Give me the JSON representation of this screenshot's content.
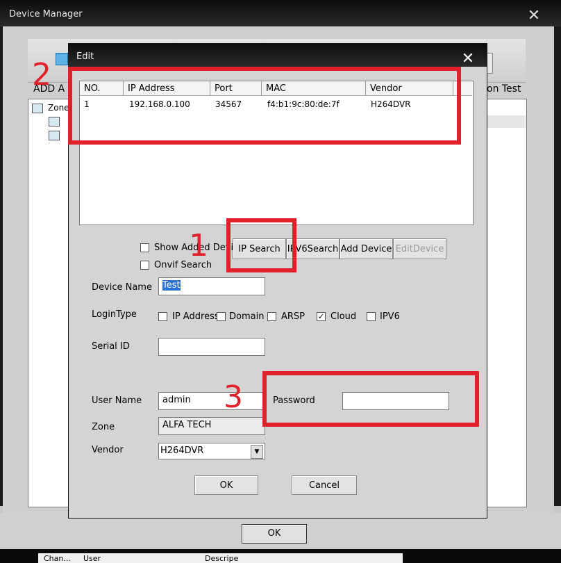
{
  "outer_window": {
    "title": "Device Manager",
    "close_glyph": "✕",
    "toolbar": {
      "left_label": "ADD A",
      "right_label": "on Test"
    },
    "tree": {
      "root_label": "Zone"
    },
    "ok_label": "OK",
    "bottom_columns": [
      "Chan...",
      "User",
      "Descripe"
    ]
  },
  "edit_dialog": {
    "title": "Edit",
    "close_glyph": "✕",
    "table": {
      "columns": [
        "NO.",
        "IP Address",
        "Port",
        "MAC",
        "Vendor"
      ],
      "rows": [
        {
          "no": "1",
          "ip": "192.168.0.100",
          "port": "34567",
          "mac": "f4:b1:9c:80:de:7f",
          "vendor": "H264DVR"
        }
      ]
    },
    "options": {
      "show_added_label": "Show Added Devi",
      "onvif_label": "Onvif Search"
    },
    "buttons": {
      "ip_search": "IP Search",
      "ipv6_search": "IPV6Search",
      "add_device": "Add Device",
      "edit_device": "EditDevice",
      "ok": "OK",
      "cancel": "Cancel"
    },
    "form": {
      "device_name_label": "Device Name",
      "device_name_value": "Test",
      "login_type_label": "LoginType",
      "login_types": [
        {
          "label": "IP Address",
          "checked": false
        },
        {
          "label": "Domain",
          "checked": false
        },
        {
          "label": "ARSP",
          "checked": false
        },
        {
          "label": "Cloud",
          "checked": true
        },
        {
          "label": "IPV6",
          "checked": false
        }
      ],
      "serial_id_label": "Serial ID",
      "serial_id_value": "",
      "user_name_label": "User Name",
      "user_name_value": "admin",
      "password_label": "Password",
      "password_value": "",
      "zone_label": "Zone",
      "zone_value": "ALFA TECH",
      "vendor_label": "Vendor",
      "vendor_value": "H264DVR",
      "check_glyph": "✓",
      "dropdown_glyph": "▼"
    }
  },
  "annotations": {
    "marker_1": "1",
    "marker_2": "2",
    "marker_3": "3",
    "color": "#e0202a"
  }
}
